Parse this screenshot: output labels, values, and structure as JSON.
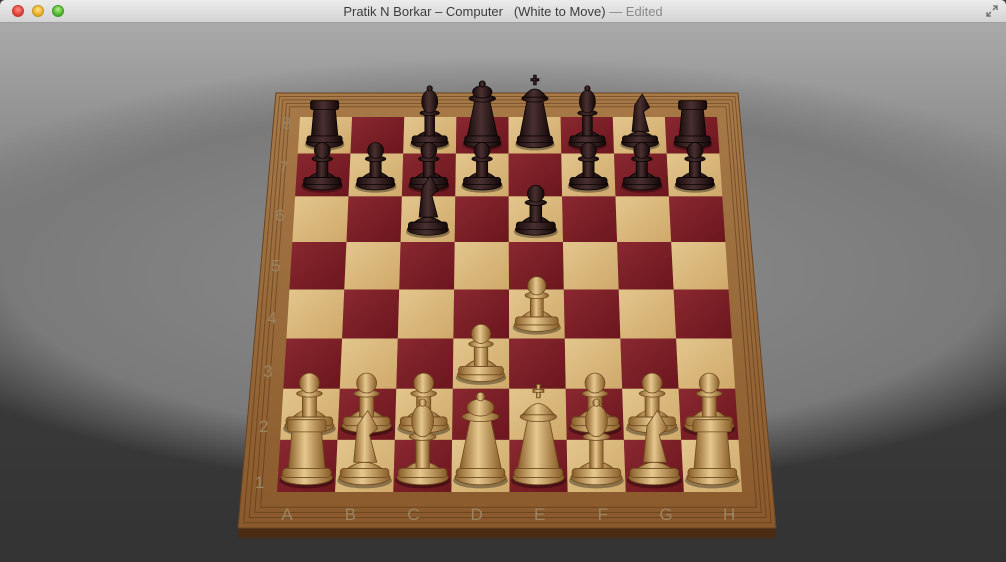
{
  "window": {
    "title_main": "Pratik N Borkar – Computer   (White to Move)",
    "title_suffix": " — Edited"
  },
  "board": {
    "files": [
      "A",
      "B",
      "C",
      "D",
      "E",
      "F",
      "G",
      "H"
    ],
    "ranks": [
      "1",
      "2",
      "3",
      "4",
      "5",
      "6",
      "7",
      "8"
    ],
    "light_square": "#d9b87a",
    "dark_square": "#7a1e24",
    "frame_color": "#9a6a3a",
    "pieces": [
      {
        "color": "white",
        "type": "rook",
        "square": "a1"
      },
      {
        "color": "white",
        "type": "knight",
        "square": "b1"
      },
      {
        "color": "white",
        "type": "bishop",
        "square": "c1"
      },
      {
        "color": "white",
        "type": "queen",
        "square": "d1"
      },
      {
        "color": "white",
        "type": "king",
        "square": "e1"
      },
      {
        "color": "white",
        "type": "bishop",
        "square": "f1"
      },
      {
        "color": "white",
        "type": "knight",
        "square": "g1"
      },
      {
        "color": "white",
        "type": "rook",
        "square": "h1"
      },
      {
        "color": "white",
        "type": "pawn",
        "square": "a2"
      },
      {
        "color": "white",
        "type": "pawn",
        "square": "b2"
      },
      {
        "color": "white",
        "type": "pawn",
        "square": "c2"
      },
      {
        "color": "white",
        "type": "pawn",
        "square": "f2"
      },
      {
        "color": "white",
        "type": "pawn",
        "square": "g2"
      },
      {
        "color": "white",
        "type": "pawn",
        "square": "h2"
      },
      {
        "color": "white",
        "type": "pawn",
        "square": "d3"
      },
      {
        "color": "white",
        "type": "pawn",
        "square": "e4"
      },
      {
        "color": "black",
        "type": "rook",
        "square": "a8"
      },
      {
        "color": "black",
        "type": "bishop",
        "square": "c8"
      },
      {
        "color": "black",
        "type": "queen",
        "square": "d8"
      },
      {
        "color": "black",
        "type": "king",
        "square": "e8"
      },
      {
        "color": "black",
        "type": "bishop",
        "square": "f8"
      },
      {
        "color": "black",
        "type": "knight",
        "square": "g8"
      },
      {
        "color": "black",
        "type": "rook",
        "square": "h8"
      },
      {
        "color": "black",
        "type": "pawn",
        "square": "a7"
      },
      {
        "color": "black",
        "type": "pawn",
        "square": "b7"
      },
      {
        "color": "black",
        "type": "pawn",
        "square": "c7"
      },
      {
        "color": "black",
        "type": "pawn",
        "square": "d7"
      },
      {
        "color": "black",
        "type": "pawn",
        "square": "f7"
      },
      {
        "color": "black",
        "type": "pawn",
        "square": "g7"
      },
      {
        "color": "black",
        "type": "pawn",
        "square": "h7"
      },
      {
        "color": "black",
        "type": "knight",
        "square": "c6"
      },
      {
        "color": "black",
        "type": "pawn",
        "square": "e6"
      }
    ]
  }
}
